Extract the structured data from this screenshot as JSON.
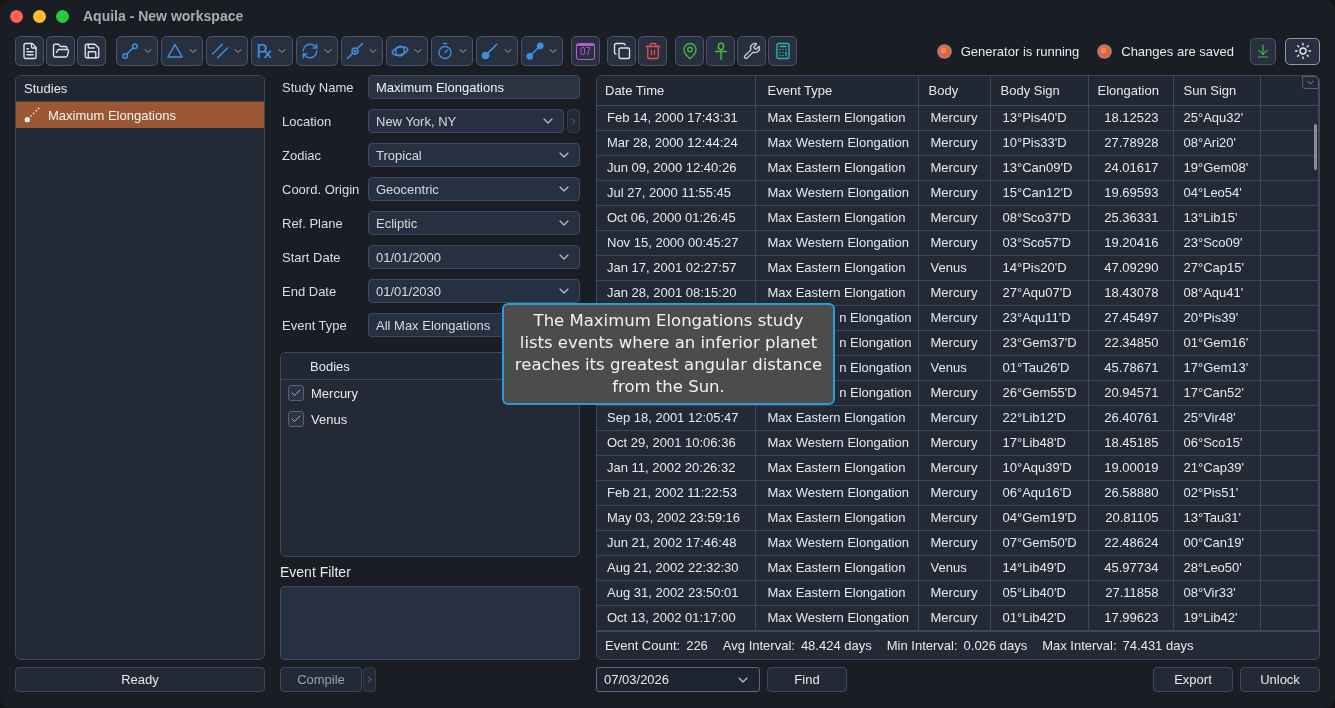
{
  "window": {
    "title": "Aquila - New workspace"
  },
  "toolbar": {
    "prescription_glyph": "℞",
    "calendar_day": "07"
  },
  "status_indicators": [
    {
      "label": "Generator is running"
    },
    {
      "label": "Changes are saved"
    }
  ],
  "studies": {
    "title": "Studies",
    "items": [
      {
        "label": "Maximum Elongations",
        "selected": true
      }
    ],
    "status": "Ready"
  },
  "study_form": {
    "fields": [
      {
        "label": "Study Name",
        "kind": "input",
        "value": "Maximum Elongations"
      },
      {
        "label": "Location",
        "kind": "dropdown_more",
        "value": "New York, NY"
      },
      {
        "label": "Zodiac",
        "kind": "dropdown",
        "value": "Tropical"
      },
      {
        "label": "Coord. Origin",
        "kind": "dropdown",
        "value": "Geocentric"
      },
      {
        "label": "Ref. Plane",
        "kind": "dropdown",
        "value": "Ecliptic"
      },
      {
        "label": "Start Date",
        "kind": "dropdown",
        "value": "01/01/2000"
      },
      {
        "label": "End Date",
        "kind": "dropdown",
        "value": "01/01/2030"
      },
      {
        "label": "Event Type",
        "kind": "plain",
        "value": "All Max Elongations"
      }
    ],
    "bodies": {
      "title": "Bodies",
      "items": [
        {
          "label": "Mercury",
          "checked": true
        },
        {
          "label": "Venus",
          "checked": true
        }
      ]
    },
    "event_filter": {
      "label": "Event Filter"
    },
    "compile_button": {
      "label": "Compile",
      "disabled": true
    }
  },
  "tooltip": {
    "lines": [
      "The Maximum Elongations study",
      "lists events where an inferior planet",
      "reaches its greatest angular distance",
      "from the Sun."
    ]
  },
  "results_table": {
    "columns": [
      "Date Time",
      "Event Type",
      "Body",
      "Body Sign",
      "Elongation",
      "Sun Sign"
    ],
    "rows": [
      {
        "date_time": "Feb 14, 2000 17:43:31",
        "event_type": "Max Eastern Elongation",
        "body": "Mercury",
        "body_sign": "13°Pis40'D",
        "elongation": "18.12523",
        "sun_sign": "25°Aqu32'"
      },
      {
        "date_time": "Mar 28, 2000 12:44:24",
        "event_type": "Max Western Elongation",
        "body": "Mercury",
        "body_sign": "10°Pis33'D",
        "elongation": "27.78928",
        "sun_sign": "08°Ari20'"
      },
      {
        "date_time": "Jun 09, 2000 12:40:26",
        "event_type": "Max Eastern Elongation",
        "body": "Mercury",
        "body_sign": "13°Can09'D",
        "elongation": "24.01617",
        "sun_sign": "19°Gem08'"
      },
      {
        "date_time": "Jul 27, 2000 11:55:45",
        "event_type": "Max Western Elongation",
        "body": "Mercury",
        "body_sign": "15°Can12'D",
        "elongation": "19.69593",
        "sun_sign": "04°Leo54'"
      },
      {
        "date_time": "Oct 06, 2000 01:26:45",
        "event_type": "Max Eastern Elongation",
        "body": "Mercury",
        "body_sign": "08°Sco37'D",
        "elongation": "25.36331",
        "sun_sign": "13°Lib15'"
      },
      {
        "date_time": "Nov 15, 2000 00:45:27",
        "event_type": "Max Western Elongation",
        "body": "Mercury",
        "body_sign": "03°Sco57'D",
        "elongation": "19.20416",
        "sun_sign": "23°Sco09'"
      },
      {
        "date_time": "Jan 17, 2001 02:27:57",
        "event_type": "Max Eastern Elongation",
        "body": "Venus",
        "body_sign": "14°Pis20'D",
        "elongation": "47.09290",
        "sun_sign": "27°Cap15'"
      },
      {
        "date_time": "Jan 28, 2001 08:15:20",
        "event_type": "Max Eastern Elongation",
        "body": "Mercury",
        "body_sign": "27°Aqu07'D",
        "elongation": "18.43078",
        "sun_sign": "08°Aqu41'"
      },
      {
        "event_type": "n Elongation",
        "body": "Mercury",
        "body_sign": "23°Aqu11'D",
        "elongation": "27.45497",
        "sun_sign": "20°Pis39'"
      },
      {
        "event_type": "n Elongation",
        "body": "Mercury",
        "body_sign": "23°Gem37'D",
        "elongation": "22.34850",
        "sun_sign": "01°Gem16'"
      },
      {
        "event_type": "n Elongation",
        "body": "Venus",
        "body_sign": "01°Tau26'D",
        "elongation": "45.78671",
        "sun_sign": "17°Gem13'"
      },
      {
        "event_type": "n Elongation",
        "body": "Mercury",
        "body_sign": "26°Gem55'D",
        "elongation": "20.94571",
        "sun_sign": "17°Can52'"
      },
      {
        "date_time": "Sep 18, 2001 12:05:47",
        "event_type": "Max Eastern Elongation",
        "body": "Mercury",
        "body_sign": "22°Lib12'D",
        "elongation": "26.40761",
        "sun_sign": "25°Vir48'"
      },
      {
        "date_time": "Oct 29, 2001 10:06:36",
        "event_type": "Max Western Elongation",
        "body": "Mercury",
        "body_sign": "17°Lib48'D",
        "elongation": "18.45185",
        "sun_sign": "06°Sco15'"
      },
      {
        "date_time": "Jan 11, 2002 20:26:32",
        "event_type": "Max Eastern Elongation",
        "body": "Mercury",
        "body_sign": "10°Aqu39'D",
        "elongation": "19.00019",
        "sun_sign": "21°Cap39'"
      },
      {
        "date_time": "Feb 21, 2002 11:22:53",
        "event_type": "Max Western Elongation",
        "body": "Mercury",
        "body_sign": "06°Aqu16'D",
        "elongation": "26.58880",
        "sun_sign": "02°Pis51'"
      },
      {
        "date_time": "May 03, 2002 23:59:16",
        "event_type": "Max Eastern Elongation",
        "body": "Mercury",
        "body_sign": "04°Gem19'D",
        "elongation": "20.81105",
        "sun_sign": "13°Tau31'"
      },
      {
        "date_time": "Jun 21, 2002 17:46:48",
        "event_type": "Max Western Elongation",
        "body": "Mercury",
        "body_sign": "07°Gem50'D",
        "elongation": "22.48624",
        "sun_sign": "00°Can19'"
      },
      {
        "date_time": "Aug 21, 2002 22:32:30",
        "event_type": "Max Eastern Elongation",
        "body": "Venus",
        "body_sign": "14°Lib49'D",
        "elongation": "45.97734",
        "sun_sign": "28°Leo50'"
      },
      {
        "date_time": "Aug 31, 2002 23:50:01",
        "event_type": "Max Eastern Elongation",
        "body": "Mercury",
        "body_sign": "05°Lib40'D",
        "elongation": "27.11858",
        "sun_sign": "08°Vir33'"
      },
      {
        "date_time": "Oct 13, 2002 01:17:00",
        "event_type": "Max Western Elongation",
        "body": "Mercury",
        "body_sign": "01°Lib42'D",
        "elongation": "17.99623",
        "sun_sign": "19°Lib42'"
      }
    ],
    "summary": [
      {
        "label": "Event Count:",
        "value": "226"
      },
      {
        "label": "Avg Interval:",
        "value": "48.424 days"
      },
      {
        "label": "Min Interval:",
        "value": "0.026 days"
      },
      {
        "label": "Max Interval:",
        "value": "74.431 days"
      }
    ]
  },
  "date_picker": {
    "value": "07/03/2026"
  },
  "find_button": "Find",
  "actions": [
    "Export",
    "Unlock"
  ]
}
